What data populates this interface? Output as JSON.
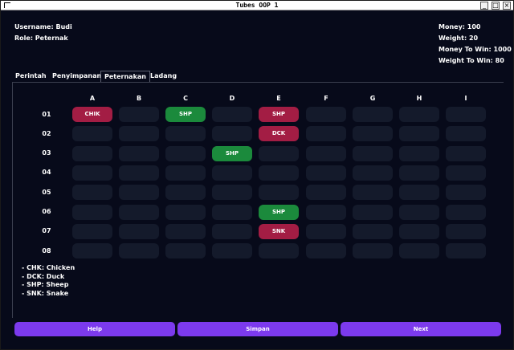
{
  "window": {
    "title": "Tubes OOP 1"
  },
  "player": {
    "username_text": "Username: Budi",
    "role_text": "Role: Peternak"
  },
  "stats": {
    "money_text": "Money: 100",
    "weight_text": "Weight: 20",
    "money_to_win_text": "Money To Win: 1000",
    "weight_to_win_text": "Weight To Win: 80"
  },
  "tabs": [
    {
      "label": "Perintah",
      "active": false
    },
    {
      "label": "Penyimpanan",
      "active": false
    },
    {
      "label": "Peternakan",
      "active": true
    },
    {
      "label": "Ladang",
      "active": false
    }
  ],
  "grid": {
    "columns": [
      "A",
      "B",
      "C",
      "D",
      "E",
      "F",
      "G",
      "H",
      "I"
    ],
    "rows": [
      "01",
      "02",
      "03",
      "04",
      "05",
      "06",
      "07",
      "08"
    ],
    "cells": [
      [
        "CHIK",
        "",
        "SHP",
        "",
        "SHP",
        "",
        "",
        "",
        ""
      ],
      [
        "",
        "",
        "",
        "",
        "DCK",
        "",
        "",
        "",
        ""
      ],
      [
        "",
        "",
        "",
        "SHP",
        "",
        "",
        "",
        "",
        ""
      ],
      [
        "",
        "",
        "",
        "",
        "",
        "",
        "",
        "",
        ""
      ],
      [
        "",
        "",
        "",
        "",
        "",
        "",
        "",
        "",
        ""
      ],
      [
        "",
        "",
        "",
        "",
        "SHP",
        "",
        "",
        "",
        ""
      ],
      [
        "",
        "",
        "",
        "",
        "SNK",
        "",
        "",
        "",
        ""
      ],
      [
        "",
        "",
        "",
        "",
        "",
        "",
        "",
        "",
        ""
      ]
    ],
    "cell_colors": [
      [
        "red",
        "",
        "green",
        "",
        "red",
        "",
        "",
        "",
        ""
      ],
      [
        "",
        "",
        "",
        "",
        "red",
        "",
        "",
        "",
        ""
      ],
      [
        "",
        "",
        "",
        "green",
        "",
        "",
        "",
        "",
        ""
      ],
      [
        "",
        "",
        "",
        "",
        "",
        "",
        "",
        "",
        ""
      ],
      [
        "",
        "",
        "",
        "",
        "",
        "",
        "",
        "",
        ""
      ],
      [
        "",
        "",
        "",
        "",
        "green",
        "",
        "",
        "",
        ""
      ],
      [
        "",
        "",
        "",
        "",
        "red",
        "",
        "",
        "",
        ""
      ],
      [
        "",
        "",
        "",
        "",
        "",
        "",
        "",
        "",
        ""
      ]
    ]
  },
  "legend": [
    "- CHK: Chicken",
    "- DCK: Duck",
    "- SHP: Sheep",
    "- SNK: Snake"
  ],
  "buttons": {
    "help_label": "Help",
    "save_label": "Simpan",
    "next_label": "Next"
  },
  "colors": {
    "background": "#070a1a",
    "empty_cell": "#141a2b",
    "red_cell": "#a31d44",
    "green_cell": "#1b8a3c",
    "button": "#7c3aed"
  }
}
